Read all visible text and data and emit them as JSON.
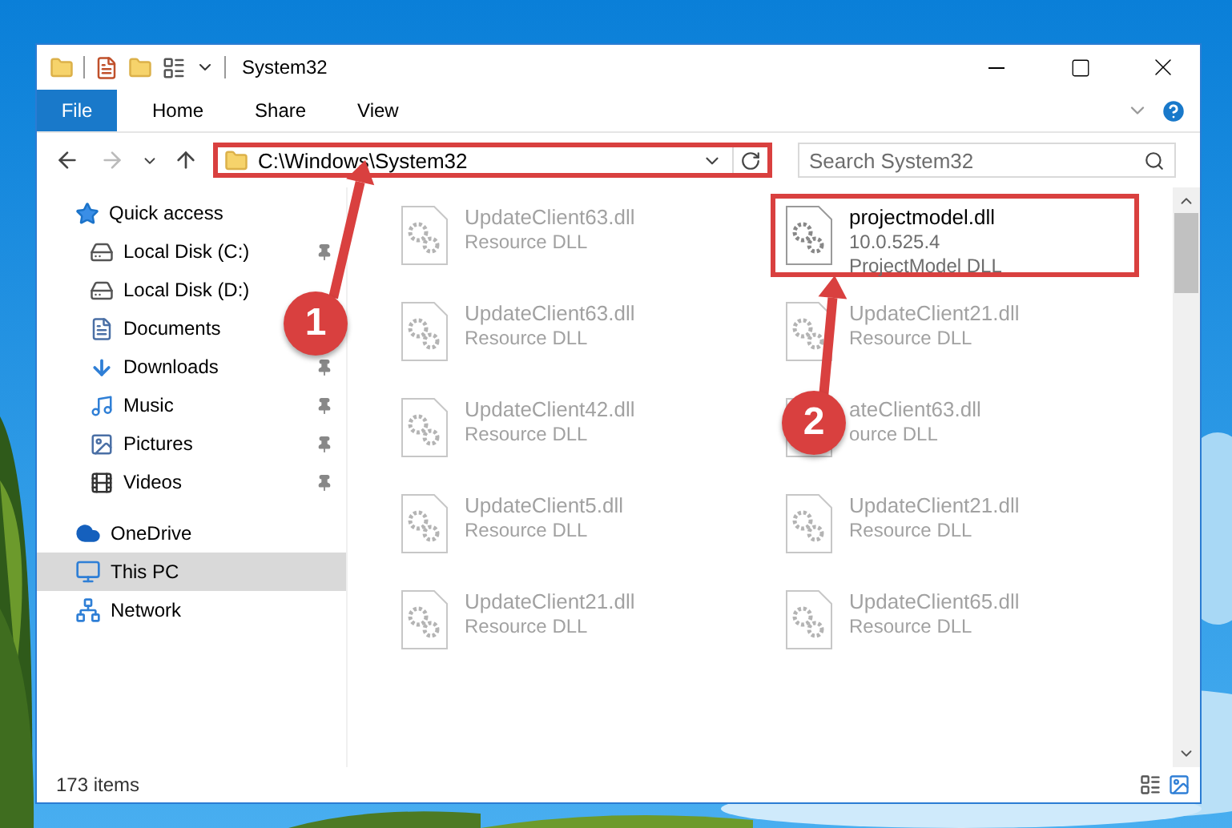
{
  "window": {
    "title": "System32"
  },
  "ribbon_tabs": [
    {
      "label": "File",
      "selected": true
    },
    {
      "label": "Home",
      "selected": false
    },
    {
      "label": "Share",
      "selected": false
    },
    {
      "label": "View",
      "selected": false
    }
  ],
  "address_bar": {
    "path": "C:\\Windows\\System32",
    "highlighted": true
  },
  "search": {
    "placeholder": "Search System32"
  },
  "sidebar": [
    {
      "label": "Quick access",
      "selected": false,
      "children": [
        {
          "label": "Local Disk (C:)",
          "pinned": true,
          "selected": false
        },
        {
          "label": "Local Disk (D:)",
          "pinned": false,
          "selected": false
        },
        {
          "label": "Documents",
          "pinned": false,
          "selected": false
        },
        {
          "label": "Downloads",
          "pinned": true,
          "selected": false
        },
        {
          "label": "Music",
          "pinned": true,
          "selected": false
        },
        {
          "label": "Pictures",
          "pinned": true,
          "selected": false
        },
        {
          "label": "Videos",
          "pinned": true,
          "selected": false
        }
      ]
    },
    {
      "label": "OneDrive",
      "selected": false
    },
    {
      "label": "This PC",
      "selected": true
    },
    {
      "label": "Network",
      "selected": false
    }
  ],
  "files": [
    {
      "name": "UpdateClient63.dll",
      "details": [
        "Resource DLL"
      ],
      "faded": true,
      "highlighted": false
    },
    {
      "name": "projectmodel.dll",
      "details": [
        "10.0.525.4",
        "ProjectModel DLL"
      ],
      "faded": false,
      "highlighted": true
    },
    {
      "name": "UpdateClient63.dll",
      "details": [
        "Resource DLL"
      ],
      "faded": true,
      "highlighted": false
    },
    {
      "name": "UpdateClient21.dll",
      "details": [
        "Resource DLL"
      ],
      "faded": true,
      "highlighted": false
    },
    {
      "name": "UpdateClient42.dll",
      "details": [
        "Resource DLL"
      ],
      "faded": true,
      "highlighted": false
    },
    {
      "name": "ateClient63.dll",
      "details": [
        "ource DLL"
      ],
      "faded": true,
      "highlighted": false
    },
    {
      "name": "UpdateClient5.dll",
      "details": [
        "Resource DLL"
      ],
      "faded": true,
      "highlighted": false
    },
    {
      "name": "UpdateClient21.dll",
      "details": [
        "Resource DLL"
      ],
      "faded": true,
      "highlighted": false
    },
    {
      "name": "UpdateClient21.dll",
      "details": [
        "Resource DLL"
      ],
      "faded": true,
      "highlighted": false
    },
    {
      "name": "UpdateClient65.dll",
      "details": [
        "Resource DLL"
      ],
      "faded": true,
      "highlighted": false
    }
  ],
  "status_bar": {
    "item_count": "173 items"
  },
  "callouts": [
    {
      "label": "1"
    },
    {
      "label": "2"
    }
  ]
}
